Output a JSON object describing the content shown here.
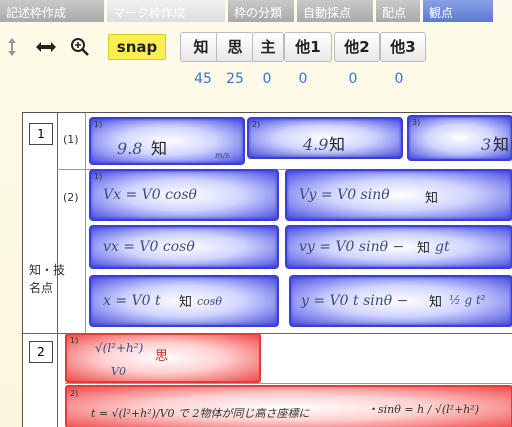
{
  "tabs": [
    {
      "label": "記述枠作成",
      "style": "grey"
    },
    {
      "label": "マーク枠作成",
      "style": "active"
    },
    {
      "label": "枠の分類",
      "style": "grey"
    },
    {
      "label": "自動採点",
      "style": "grey"
    },
    {
      "label": "配点",
      "style": "grey"
    },
    {
      "label": "観点",
      "style": "blue"
    }
  ],
  "toolbar": {
    "snap_label": "snap",
    "categories": [
      {
        "label": "知",
        "count": "45"
      },
      {
        "label": "思",
        "count": "25"
      },
      {
        "label": "主",
        "count": "0"
      },
      {
        "label": "他1",
        "count": "0"
      },
      {
        "label": "他2",
        "count": "0"
      },
      {
        "label": "他3",
        "count": "0"
      }
    ]
  },
  "sheet": {
    "q1_label": "1",
    "q2_label": "2",
    "sub1": "(1)",
    "sub2": "(2)",
    "side_label": "知・技\n名点",
    "boxes": {
      "b1": {
        "idx": "1)",
        "hw": "9.8",
        "tag": "知",
        "unit": "m/s"
      },
      "b2": {
        "idx": "2)",
        "hw": "4.9",
        "tag": "知"
      },
      "b3": {
        "idx": "3)",
        "hw": "3",
        "tag": "知"
      },
      "b4": {
        "idx": "1)",
        "hw": "Vx = V0 cosθ",
        "tag": "知"
      },
      "b5": {
        "idx": "",
        "hw": "Vy = V0 sinθ",
        "tag": "知"
      },
      "b6": {
        "idx": "",
        "hw": "vx = V0 cosθ",
        "tag": "知"
      },
      "b7": {
        "idx": "",
        "hw": "vy = V0 sinθ −",
        "tag": "知",
        "tail": "gt"
      },
      "b8": {
        "idx": "",
        "hw": "x = V0 t",
        "tag": "知",
        "tail": "cosθ"
      },
      "b9": {
        "idx": "",
        "hw": "y = V0 t sinθ −",
        "tag": "知",
        "tail": "½ g t²"
      },
      "r1": {
        "idx": "1)",
        "hw": "√(l²+h²)",
        "tag": "思",
        "denom": "V0"
      }
    },
    "bottom_note": "t = √(l²+h²)/V0 で 2物体が同じ高さ座標に",
    "bottom_note_right": "・sinθ = h / √(l²+h²)"
  }
}
